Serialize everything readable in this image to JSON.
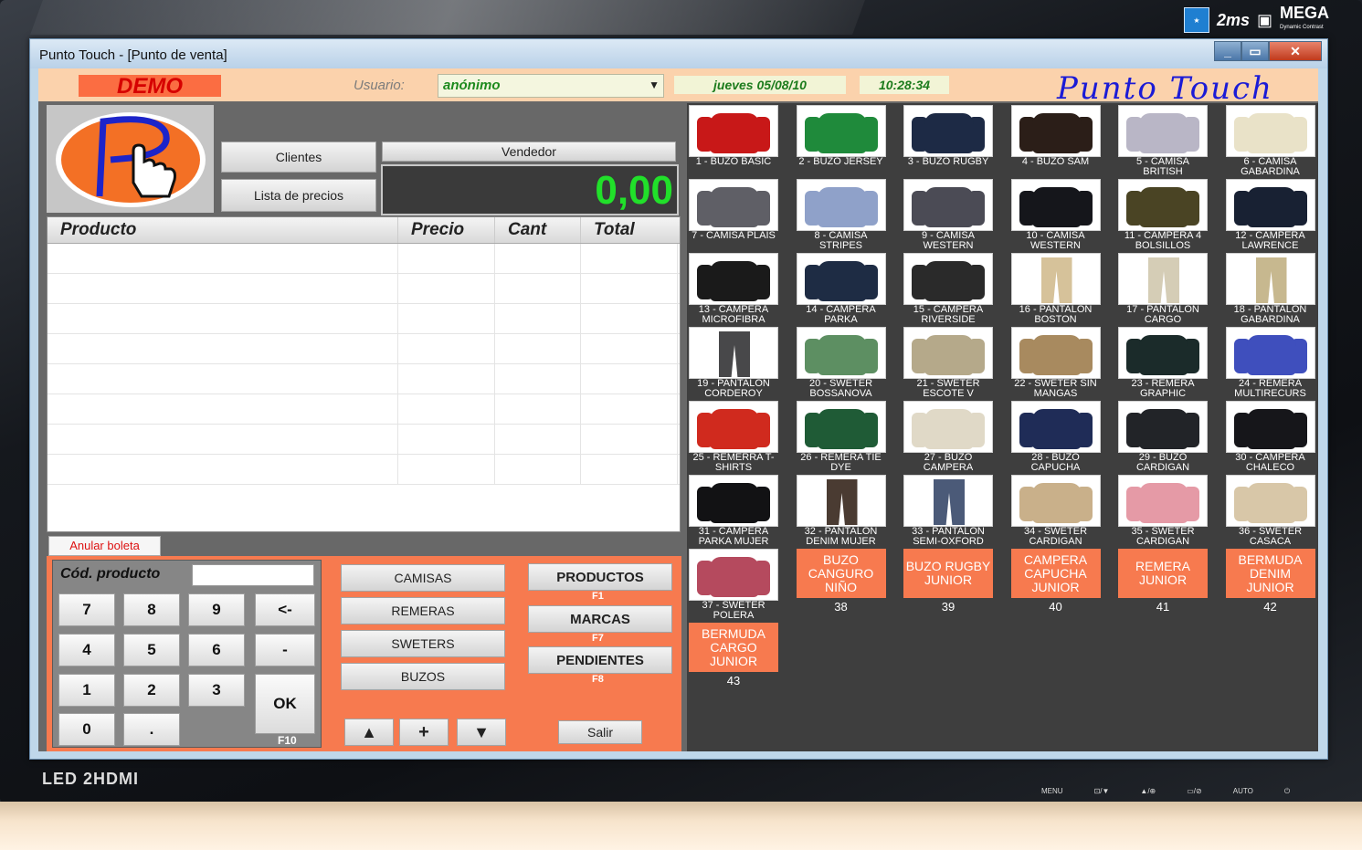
{
  "window": {
    "title": "Punto Touch - [Punto de venta]"
  },
  "monitor": {
    "ms_badge": "2ms",
    "mega": "MEGA",
    "mega_sub": "Dynamic Contrast",
    "led": "LED 2HDMI",
    "controls": [
      "MENU",
      "⊡/▼",
      "▲/⊕",
      "▭/⊘",
      "AUTO",
      "⏻"
    ]
  },
  "header": {
    "demo": "DEMO",
    "user_label": "Usuario:",
    "user_value": "anónimo",
    "date": "jueves 05/08/10",
    "time": "10:28:34",
    "brand": "Punto Touch"
  },
  "left": {
    "clientes": "Clientes",
    "lista_precios": "Lista de precios",
    "vendedor": "Vendedor",
    "total": "0,00",
    "grid_headers": [
      "Producto",
      "Precio",
      "Cant",
      "Total"
    ],
    "anular": "Anular boleta",
    "cod_label": "Cód. producto",
    "keys": [
      "7",
      "8",
      "9",
      "<-",
      "4",
      "5",
      "6",
      "-",
      "1",
      "2",
      "3",
      "OK",
      "0",
      "."
    ],
    "f10": "F10",
    "categories": [
      "CAMISAS",
      "REMERAS",
      "SWETERS",
      "BUZOS"
    ],
    "actions": [
      {
        "label": "PRODUCTOS",
        "key": "F1"
      },
      {
        "label": "MARCAS",
        "key": "F7"
      },
      {
        "label": "PENDIENTES",
        "key": "F8"
      }
    ],
    "nav": [
      "▲",
      "+",
      "▼"
    ],
    "salir": "Salir"
  },
  "products": [
    {
      "label": "1 - BUZO BASIC",
      "color": "#c81818",
      "kind": "top"
    },
    {
      "label": "2 - BUZO JERSEY",
      "color": "#1f8a3b",
      "kind": "top"
    },
    {
      "label": "3 - BUZO RUGBY",
      "color": "#1d2a45",
      "kind": "top"
    },
    {
      "label": "4 - BUZO SAM",
      "color": "#2b1e18",
      "kind": "top"
    },
    {
      "label": "5 - CAMISA BRITISH",
      "color": "#b9b6c6",
      "kind": "top"
    },
    {
      "label": "6 - CAMISA GABARDINA",
      "color": "#e9e2c8",
      "kind": "top"
    },
    {
      "label": "7 - CAMISA PLAIS",
      "color": "#5f5f66",
      "kind": "top"
    },
    {
      "label": "8 - CAMISA STRIPES",
      "color": "#8fa1c9",
      "kind": "top"
    },
    {
      "label": "9 - CAMISA WESTERN",
      "color": "#4b4b55",
      "kind": "top"
    },
    {
      "label": "10 - CAMISA WESTERN",
      "color": "#15161b",
      "kind": "top"
    },
    {
      "label": "11 - CAMPERA 4 BOLSILLOS",
      "color": "#4a4424",
      "kind": "top"
    },
    {
      "label": "12 - CAMPERA LAWRENCE",
      "color": "#182133",
      "kind": "top"
    },
    {
      "label": "13 - CAMPERA MICROFIBRA",
      "color": "#1a1a1a",
      "kind": "top"
    },
    {
      "label": "14 - CAMPERA PARKA",
      "color": "#1e2c44",
      "kind": "top"
    },
    {
      "label": "15 - CAMPERA RIVERSIDE",
      "color": "#2a2a2a",
      "kind": "top"
    },
    {
      "label": "16 - PANTALON BOSTON",
      "color": "#d6c29a",
      "kind": "pants"
    },
    {
      "label": "17 - PANTALON CARGO",
      "color": "#d5cdb6",
      "kind": "pants"
    },
    {
      "label": "18 - PANTALON GABARDINA",
      "color": "#c7b88f",
      "kind": "pants"
    },
    {
      "label": "19 - PANTALON CORDEROY",
      "color": "#48484a",
      "kind": "pants"
    },
    {
      "label": "20 - SWETER BOSSANOVA",
      "color": "#5d8f62",
      "kind": "top"
    },
    {
      "label": "21 - SWETER ESCOTE V",
      "color": "#b5a98a",
      "kind": "top"
    },
    {
      "label": "22 - SWETER SIN MANGAS",
      "color": "#a88a5f",
      "kind": "top"
    },
    {
      "label": "23 - REMERA GRAPHIC",
      "color": "#1b2b2a",
      "kind": "top"
    },
    {
      "label": "24 - REMERA MULTIRECURS",
      "color": "#3f4fbd",
      "kind": "top"
    },
    {
      "label": "25 - REMERRA T-SHIRTS",
      "color": "#d02a1e",
      "kind": "top"
    },
    {
      "label": "26 - REMERA TIE DYE",
      "color": "#1f5b36",
      "kind": "top"
    },
    {
      "label": "27 - BUZO CAMPERA",
      "color": "#e0d9c7",
      "kind": "top"
    },
    {
      "label": "28 - BUZO CAPUCHA",
      "color": "#1f2c57",
      "kind": "top"
    },
    {
      "label": "29 - BUZO CARDIGAN",
      "color": "#222428",
      "kind": "top"
    },
    {
      "label": "30 - CAMPERA CHALECO",
      "color": "#16161a",
      "kind": "top"
    },
    {
      "label": "31 - CAMPERA PARKA MUJER",
      "color": "#121214",
      "kind": "top"
    },
    {
      "label": "32 - PANTALON DENIM MUJER",
      "color": "#4a3b32",
      "kind": "pants"
    },
    {
      "label": "33 - PANTALON SEMI-OXFORD",
      "color": "#4b5a78",
      "kind": "pants"
    },
    {
      "label": "34 - SWETER CARDIGAN",
      "color": "#c9b08a",
      "kind": "top"
    },
    {
      "label": "35 - SWETER CARDIGAN",
      "color": "#e59aa6",
      "kind": "top"
    },
    {
      "label": "36 - SWETER CASACA",
      "color": "#d8c7a8",
      "kind": "top"
    },
    {
      "label": "37 - SWETER POLERA",
      "color": "#b54a5e",
      "kind": "top"
    }
  ],
  "orange_products": [
    {
      "label": "BUZO CANGURO NIÑO",
      "num": "38"
    },
    {
      "label": "BUZO RUGBY JUNIOR",
      "num": "39"
    },
    {
      "label": "CAMPERA CAPUCHA JUNIOR",
      "num": "40"
    },
    {
      "label": "REMERA JUNIOR",
      "num": "41"
    },
    {
      "label": "BERMUDA DENIM JUNIOR",
      "num": "42"
    },
    {
      "label": "BERMUDA CARGO JUNIOR",
      "num": "43"
    }
  ]
}
